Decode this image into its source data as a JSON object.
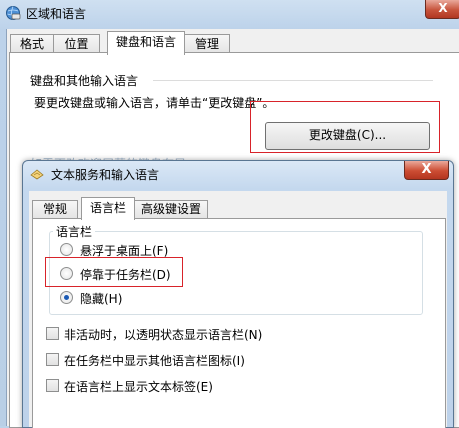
{
  "outer_window": {
    "title": "区域和语言",
    "close_glyph": "X",
    "tabs": [
      "格式",
      "位置",
      "键盘和语言",
      "管理"
    ],
    "active_tab": "键盘和语言",
    "section_label": "键盘和其他输入语言",
    "info_text": "要更改键盘或输入语言，请单击“更改键盘”。",
    "change_button_label": "更改键盘(C)...",
    "obscured_text": "如需更改欢迎屏幕的键盘布局"
  },
  "inner_window": {
    "title": "文本服务和输入语言",
    "close_glyph": "X",
    "tabs": [
      "常规",
      "语言栏",
      "高级键设置"
    ],
    "active_tab": "语言栏",
    "group_label": "语言栏",
    "radios": [
      {
        "label": "悬浮于桌面上(F)",
        "checked": false
      },
      {
        "label": "停靠于任务栏(D)",
        "checked": false
      },
      {
        "label": "隐藏(H)",
        "checked": true
      }
    ],
    "checkboxes": [
      {
        "label": "非活动时，以透明状态显示语言栏(N)",
        "checked": false
      },
      {
        "label": "在任务栏中显示其他语言栏图标(I)",
        "checked": false
      },
      {
        "label": "在语言栏上显示文本标签(E)",
        "checked": false
      }
    ]
  },
  "colors": {
    "highlight_box": "#d8232a",
    "title_bar": "#bcd3ea",
    "close_button": "#c7543c"
  },
  "icons": {
    "outer_app": "globe-keyboard-icon",
    "inner_app": "keyboard-icon"
  }
}
